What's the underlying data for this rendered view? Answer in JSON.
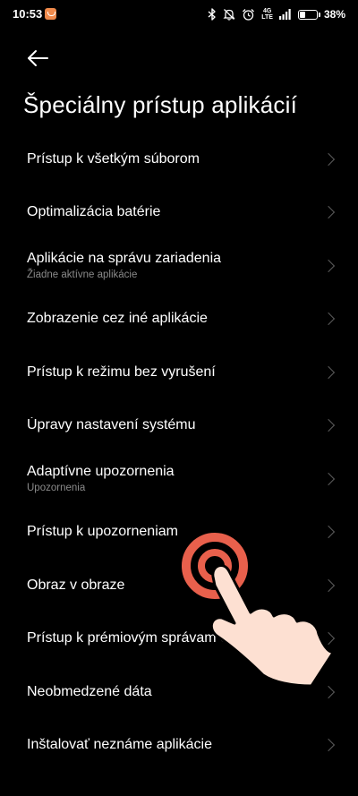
{
  "status_bar": {
    "time": "10:53",
    "battery_level": "38%",
    "battery_fraction": 0.38,
    "network_label_top": "4G",
    "network_label_bottom": "LTE"
  },
  "header": {
    "title": "Špeciálny prístup aplikácií"
  },
  "items": [
    {
      "title": "Prístup k všetkým súborom",
      "subtitle": ""
    },
    {
      "title": "Optimalizácia batérie",
      "subtitle": ""
    },
    {
      "title": "Aplikácie na správu zariadenia",
      "subtitle": "Žiadne aktívne aplikácie"
    },
    {
      "title": "Zobrazenie cez iné aplikácie",
      "subtitle": ""
    },
    {
      "title": "Prístup k režimu bez vyrušení",
      "subtitle": ""
    },
    {
      "title": "Úpravy nastavení systému",
      "subtitle": ""
    },
    {
      "title": "Adaptívne upozornenia",
      "subtitle": "Upozornenia"
    },
    {
      "title": "Prístup k upozorneniam",
      "subtitle": ""
    },
    {
      "title": "Obraz v obraze",
      "subtitle": ""
    },
    {
      "title": "Prístup k prémiovým správam SMS",
      "subtitle": ""
    },
    {
      "title": "Neobmedzené dáta",
      "subtitle": ""
    },
    {
      "title": "Inštalovať neznáme aplikácie",
      "subtitle": ""
    }
  ],
  "colors": {
    "background": "#000000",
    "text": "#ffffff",
    "subtitle": "#8a8a8a",
    "tap_ring": "#e8604c",
    "hand_skin": "#fde0d2"
  },
  "icons": {
    "back": "back-arrow-icon",
    "chevron": "chevron-right-icon",
    "tap": "tap-gesture-icon"
  }
}
